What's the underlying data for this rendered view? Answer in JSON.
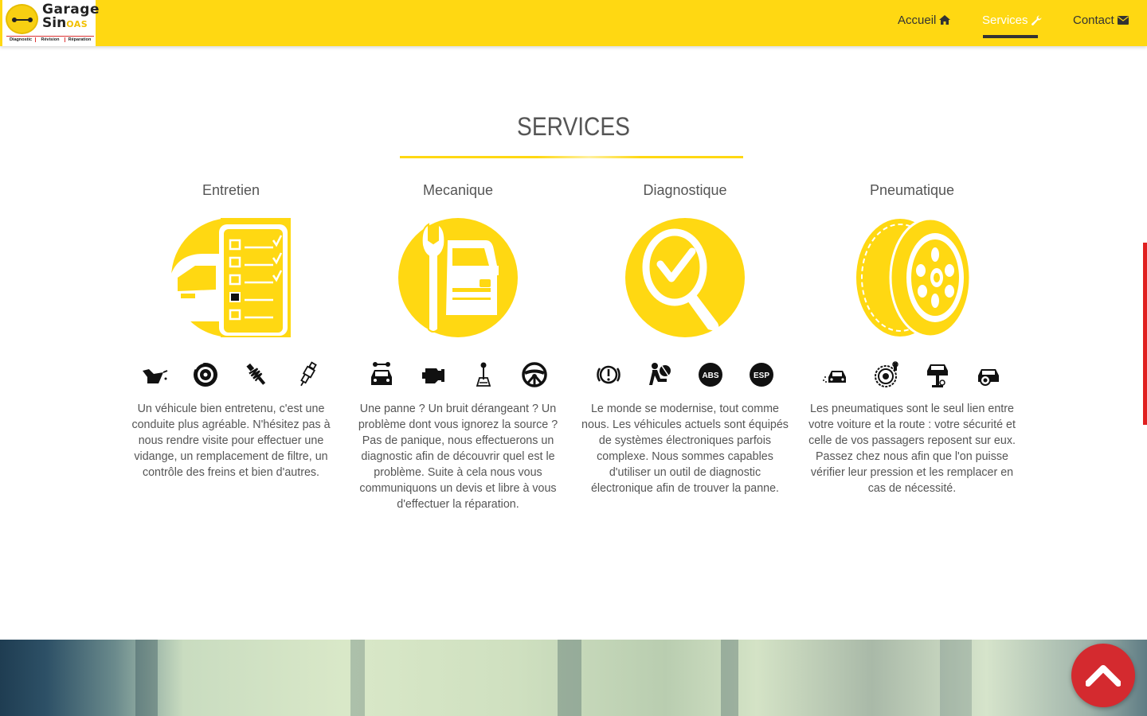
{
  "header": {
    "logo": {
      "line1": "Garage",
      "line2_main": "Sin",
      "line2_accent": "OAS",
      "tagline": [
        "Diagnostic",
        "Révision",
        "Réparation"
      ]
    },
    "nav": [
      {
        "label": "Accueil",
        "icon": "home-icon",
        "active": false
      },
      {
        "label": "Services",
        "icon": "wrench-icon",
        "active": true
      },
      {
        "label": "Contact",
        "icon": "envelope-icon",
        "active": false
      }
    ]
  },
  "services": {
    "title": "SERVICES",
    "items": [
      {
        "title": "Entretien",
        "illustration": "car-checklist-icon",
        "icons": [
          "oil-can-icon",
          "brake-disc-icon",
          "shock-absorber-icon",
          "spark-plug-icon"
        ],
        "text": "Un véhicule bien entretenu, c'est une conduite plus agréable. N'hésitez pas à nous rendre visite pour effectuer une vidange, un remplacement de filtre, un contrôle des freins et bien d'autres."
      },
      {
        "title": "Mecanique",
        "illustration": "wrench-car-icon",
        "icons": [
          "car-repair-icon",
          "engine-icon",
          "gear-shift-icon",
          "steering-wheel-icon"
        ],
        "text": "Une panne ? Un bruit dérangeant ? Un problème dont vous ignorez la source ? Pas de panique, nous effectuerons un diagnostic afin de découvrir quel est le problème. Suite à cela nous vous communiquons un devis et libre à vous d'effectuer la réparation."
      },
      {
        "title": "Diagnostique",
        "illustration": "magnifier-check-icon",
        "icons": [
          "brake-warning-icon",
          "airbag-icon",
          "abs-icon",
          "esp-icon"
        ],
        "icon_labels": {
          "abs": "ABS",
          "esp": "ESP"
        },
        "text": "Le monde se modernise, tout comme nous. Les véhicules actuels sont équipés de systèmes électroniques parfois complexe. Nous sommes capables d'utiliser un outil de diagnostic électronique afin de trouver la panne."
      },
      {
        "title": "Pneumatique",
        "illustration": "tire-icon",
        "icons": [
          "car-skid-icon",
          "tire-gauge-icon",
          "car-lift-icon",
          "car-wheel-icon"
        ],
        "text": "Les pneumatiques sont le seul lien entre votre voiture et la route : votre sécurité et celle de vos passagers reposent sur eux. Passez chez nous afin que l'on puisse vérifier leur pression et les remplacer en cas de nécessité."
      }
    ]
  },
  "colors": {
    "brand_yellow": "#ffd812",
    "accent_red": "#d42a2f",
    "text_gray": "#555555"
  },
  "scroll_top": {
    "icon": "chevron-up-icon"
  }
}
